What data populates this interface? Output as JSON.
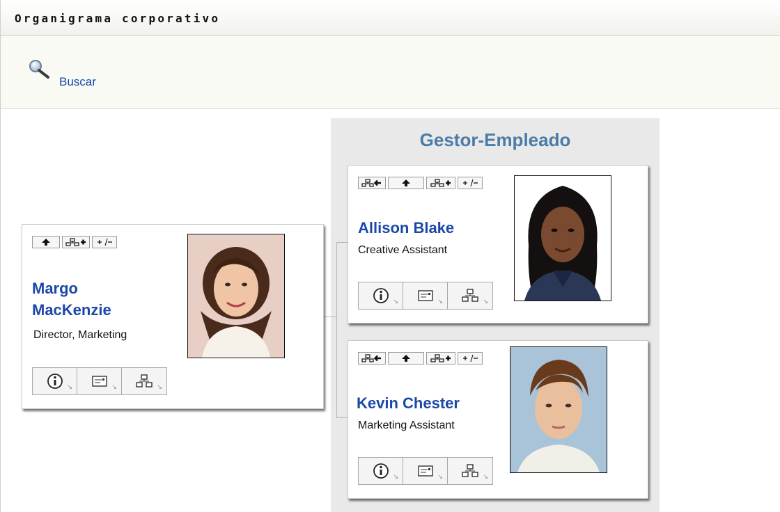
{
  "header": {
    "title": "Organigrama corporativo"
  },
  "toolbar": {
    "search_label": "Buscar",
    "search_icon": "magnifier-icon"
  },
  "panel": {
    "title": "Gestor-Empleado"
  },
  "people": {
    "root": {
      "name_line1": "Margo",
      "name_line2": "MacKenzie",
      "role": "Director, Marketing"
    },
    "report1": {
      "name": "Allison Blake",
      "role": "Creative Assistant"
    },
    "report2": {
      "name": "Kevin Chester",
      "role": "Marketing Assistant"
    }
  },
  "icons": {
    "show_hierarchy": "show-hierarchy-icon",
    "up": "up-arrow-icon",
    "add_relationship": "add-relationship-icon",
    "expand_collapse": "expand-collapse-icon",
    "info": "info-icon",
    "email": "email-icon",
    "org_chart": "org-chart-icon"
  },
  "colors": {
    "link": "#1646a8",
    "person_name": "#1c48a8",
    "panel_title": "#4a7ca8",
    "panel_bg": "#e9e9e9"
  }
}
